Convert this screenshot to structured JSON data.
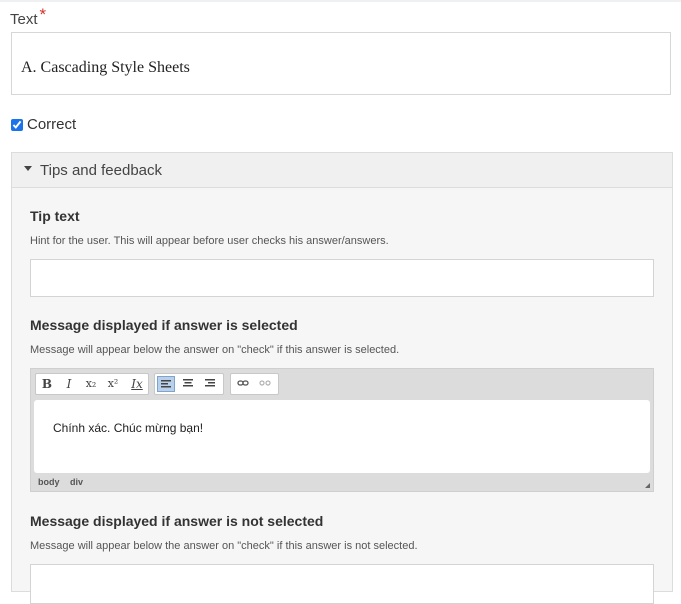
{
  "text_field": {
    "label": "Text",
    "required_mark": "*",
    "value": "A. Cascading Style Sheets"
  },
  "correct": {
    "label": "Correct",
    "checked": true
  },
  "tips_panel": {
    "title": "Tips and feedback",
    "tip_text": {
      "label": "Tip text",
      "description": "Hint for the user. This will appear before user checks his answer/answers.",
      "value": ""
    },
    "selected_message": {
      "label": "Message displayed if answer is selected",
      "description": "Message will appear below the answer on \"check\" if this answer is selected.",
      "editor": {
        "toolbar": [
          "B",
          "I",
          "x₂",
          "x²",
          "Ix",
          "align-left",
          "align-center",
          "align-right",
          "link",
          "unlink"
        ],
        "content": "Chính xác. Chúc mừng bạn!",
        "path": [
          "body",
          "div"
        ]
      }
    },
    "not_selected_message": {
      "label": "Message displayed if answer is not selected",
      "description": "Message will appear below the answer on \"check\" if this answer is not selected."
    }
  }
}
